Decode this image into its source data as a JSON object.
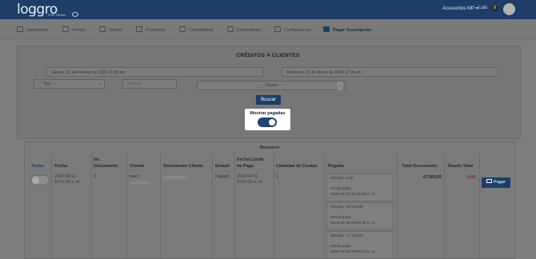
{
  "topbar": {
    "logo": "loggro",
    "logo_sub": "POS Tienda",
    "store": "Accesorios MP",
    "user": "Luis",
    "notifications": "0"
  },
  "nav": {
    "items": [
      {
        "label": "Dashboard",
        "icon": "dashboard-icon"
      },
      {
        "label": "Vender",
        "icon": "cart-icon"
      },
      {
        "label": "Ventas",
        "icon": "dollar-icon"
      },
      {
        "label": "Productos",
        "icon": "box-icon"
      },
      {
        "label": "Contabilidad",
        "icon": "ledger-icon"
      },
      {
        "label": "Estadísticas",
        "icon": "stats-icon"
      },
      {
        "label": "Configuración",
        "icon": "gear-icon"
      },
      {
        "label": "Pagar Suscripción",
        "icon": "card-icon",
        "active": true
      }
    ]
  },
  "filters": {
    "title": "CRÉDITOS A CLIENTES",
    "date_from": "Jueves, 15 de Febrero de 2024 12:00 am",
    "date_to": "Miércoles, 20 de Marzo de 2024 12:00 am",
    "tipo_select": "--- Tipo ---",
    "numero_placeholder": "Número",
    "cliente_select": "-- Cliente --",
    "buscar_label": "Buscar",
    "mostrar_pagadas_label": "Mostrar pagadas",
    "mostrar_pagadas_on": true
  },
  "table": {
    "caption": "Resumen",
    "headers": {
      "todas": "Todas",
      "fecha": "Fecha",
      "numero": [
        "No.",
        "Documento"
      ],
      "cliente": "Cliente",
      "documento_cliente": "Documento Cliente",
      "estado": "Estado",
      "fecha_limite": [
        "Fecha Límite",
        "de Pago"
      ],
      "cuotas": "Cantidad de Cuotas",
      "pagado": "Pagado",
      "total": "Total Documento",
      "deuda": "Deuda Total"
    },
    "row": {
      "fecha": [
        "2024-03-12",
        "10:11:33 a. m."
      ],
      "numero": "3",
      "cliente": "mary",
      "estado": "Pagado",
      "fecha_limite": [
        "2024-04-11",
        "10:11:33 a. m."
      ],
      "cuotas": "1",
      "pagos": [
        {
          "efectivo": "Efectivo: 0,00",
          "fecha_label": "Fecha pago:",
          "fecha": "2024-03-12 10:10:29 a. m."
        },
        {
          "efectivo": "Efectivo: 50.000,00",
          "fecha_label": "Fecha pago:",
          "fecha": "2024-03-19 09:58:45 a. m."
        },
        {
          "efectivo": "Efectivo: 17.000,00",
          "fecha_label": "Fecha pago:",
          "fecha": "2024-03-19 09:59:12 a. m."
        }
      ],
      "total": "67.000,00",
      "deuda": "0,00",
      "pagar_label": "Pagar"
    }
  },
  "colors": {
    "primary": "#1c3e68",
    "danger": "#b31212"
  }
}
